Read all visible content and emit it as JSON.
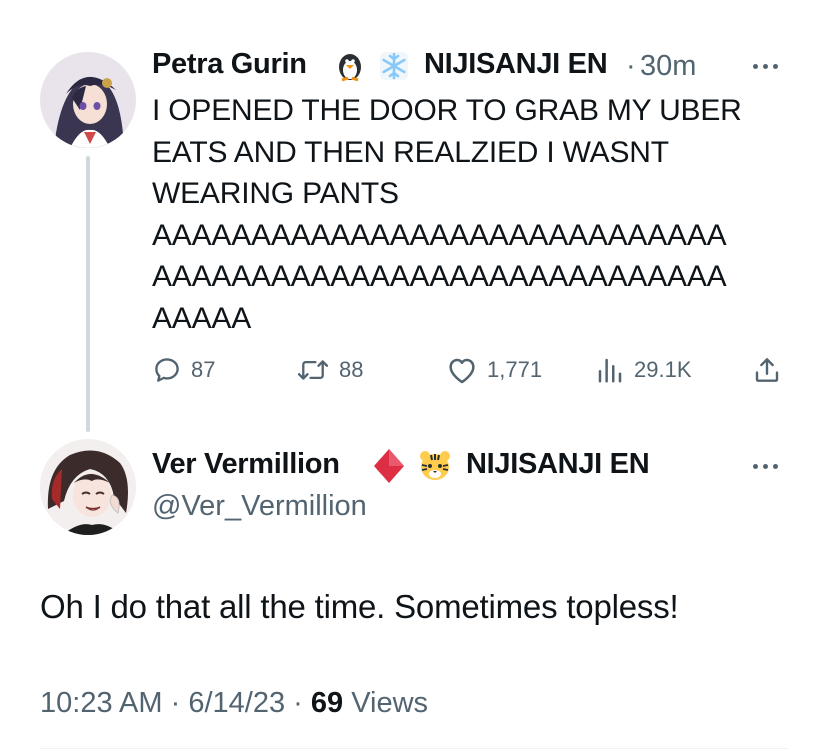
{
  "parent_tweet": {
    "author_name": "Petra Gurin",
    "author_emojis": [
      "🐧",
      "❄️"
    ],
    "affiliation": "NIJISANJI EN",
    "separator": "·",
    "time_ago": "30m",
    "text": "I OPENED THE DOOR TO GRAB MY UBER\nEATS AND THEN REALZIED I WASNT\nWEARING PANTS\nAAAAAAAAAAAAAAAAAAAAAAAAAAAAA\nAAAAAAAAAAAAAAAAAAAAAAAAAAAAA\nAAAAA",
    "actions": {
      "replies": "87",
      "retweets": "88",
      "likes": "1,771",
      "views": "29.1K"
    }
  },
  "reply_tweet": {
    "author_name": "Ver Vermillion",
    "author_emojis": [
      "♦️",
      "🐯"
    ],
    "affiliation": "NIJISANJI EN",
    "handle": "@Ver_Vermillion",
    "text": "Oh I do that all the time. Sometimes topless!",
    "time": "10:23 AM",
    "separator": "·",
    "date": "6/14/23",
    "views_count": "69",
    "views_label": "Views"
  },
  "icons": {
    "reply": "reply-icon",
    "retweet": "retweet-icon",
    "like": "heart-icon",
    "views": "views-icon",
    "share": "share-icon",
    "more": "more-icon"
  },
  "colors": {
    "text": "#0f1419",
    "secondary": "#536471",
    "thread_line": "#cfd9de"
  }
}
